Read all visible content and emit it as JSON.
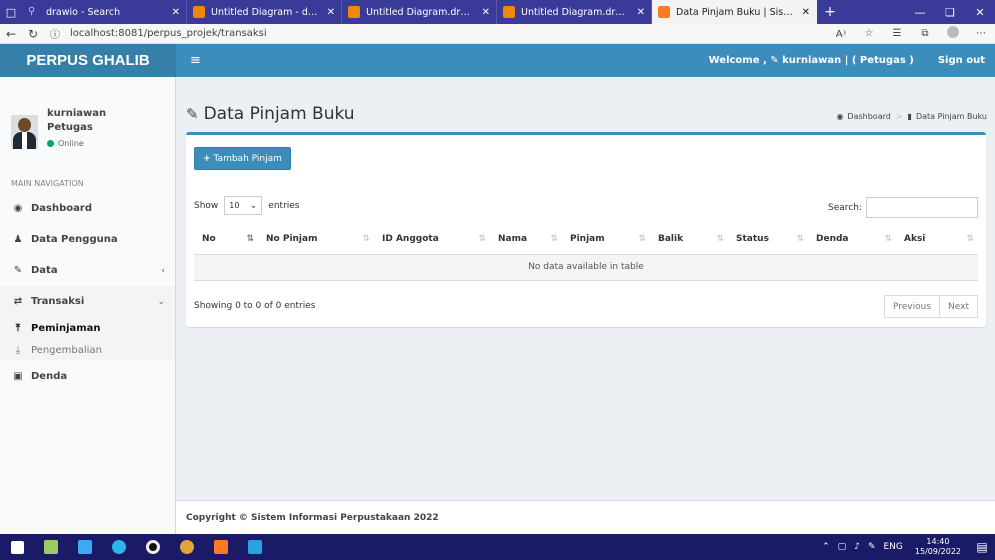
{
  "browser": {
    "tabs": [
      {
        "title": "drawio - Search",
        "active": false
      },
      {
        "title": "Untitled Diagram - diagrams.",
        "active": false
      },
      {
        "title": "Untitled Diagram.drawio - dia",
        "active": false
      },
      {
        "title": "Untitled Diagram.drawio - dia",
        "active": false
      },
      {
        "title": "Data Pinjam Buku | Sistem Inf",
        "active": true
      }
    ],
    "url": "localhost:8081/perpus_projek/transaksi"
  },
  "app": {
    "logo": "PERPUS GHALIB",
    "welcome": "Welcome , ✎ kurniawan | ( Petugas )",
    "signout": "Sign out"
  },
  "sidebar": {
    "user": {
      "name": "kurniawan",
      "role": "Petugas",
      "status": "Online"
    },
    "nav_header": "MAIN NAVIGATION",
    "items": [
      {
        "label": "Dashboard",
        "icon": "dashboard-icon"
      },
      {
        "label": "Data Pengguna",
        "icon": "user-icon"
      },
      {
        "label": "Data",
        "icon": "edit-icon"
      },
      {
        "label": "Transaksi",
        "icon": "exchange-icon"
      }
    ],
    "submenu": [
      {
        "label": "Peminjaman",
        "active": true
      },
      {
        "label": "Pengembalian",
        "active": false
      }
    ],
    "denda": "Denda"
  },
  "content": {
    "title": "Data Pinjam Buku",
    "breadcrumb": {
      "home": "Dashboard",
      "current": "Data Pinjam Buku"
    },
    "add_button": "Tambah Pinjam",
    "show_label": "Show",
    "entries_value": "10",
    "entries_label": "entries",
    "search_label": "Search:",
    "columns": [
      "No",
      "No Pinjam",
      "ID Anggota",
      "Nama",
      "Pinjam",
      "Balik",
      "Status",
      "Denda",
      "Aksi"
    ],
    "empty_message": "No data available in table",
    "info": "Showing 0 to 0 of 0 entries",
    "pager": {
      "previous": "Previous",
      "next": "Next"
    }
  },
  "footer": "Copyright © Sistem Informasi Perpustakaan 2022",
  "taskbar": {
    "lang": "ENG",
    "time": "14:40",
    "date": "15/09/2022"
  }
}
